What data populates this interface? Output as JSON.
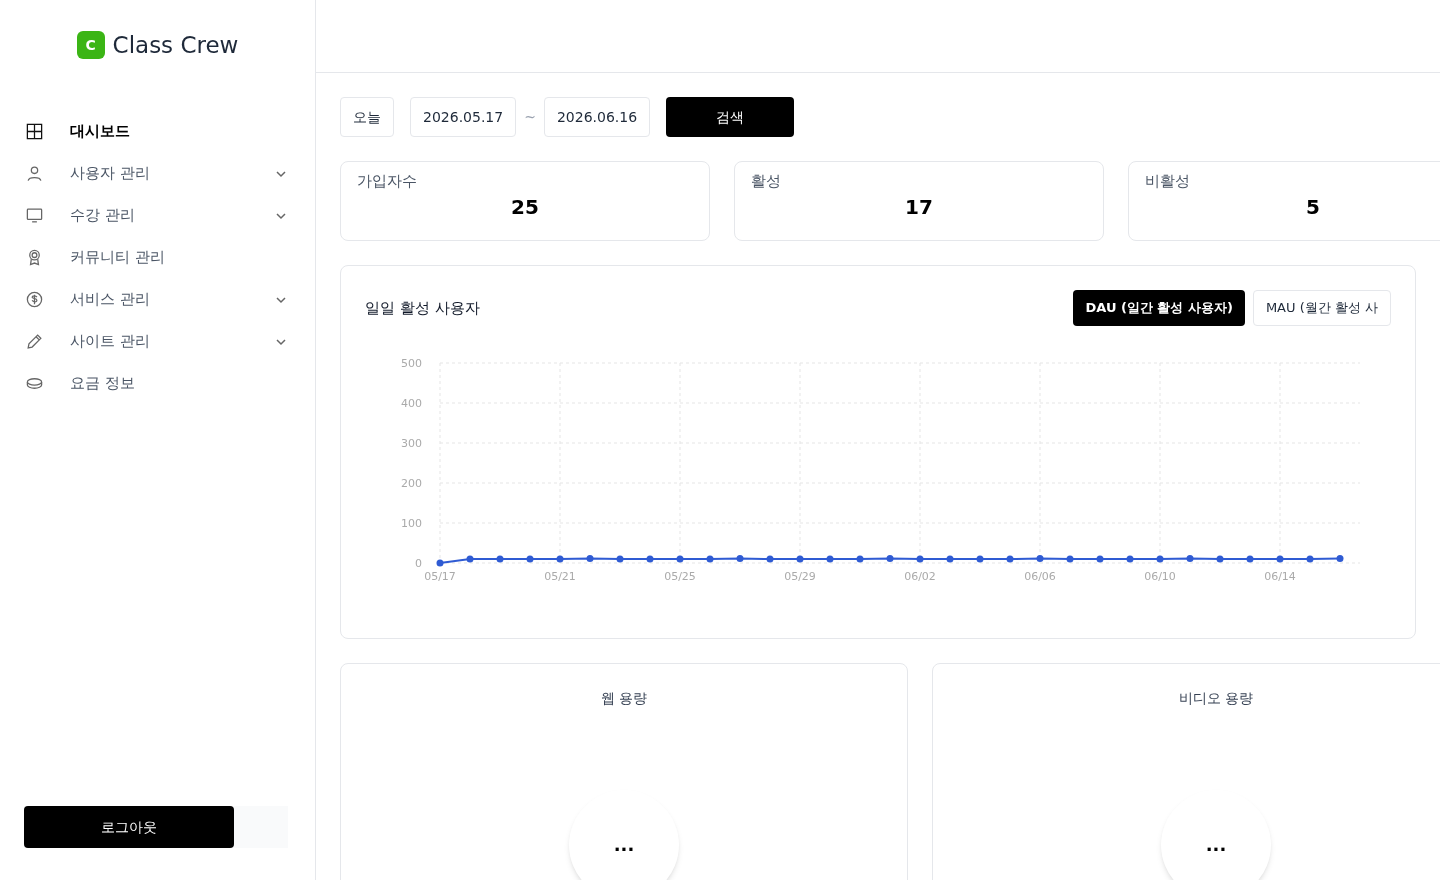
{
  "brand": {
    "logo_letter": "C",
    "name": "Class Crew"
  },
  "sidebar": {
    "items": [
      {
        "kind": "grid",
        "label": "대시보드",
        "selected": true,
        "has_children": false
      },
      {
        "kind": "user",
        "label": "사용자 관리",
        "selected": false,
        "has_children": true
      },
      {
        "kind": "monitor",
        "label": "수강 관리",
        "selected": false,
        "has_children": true
      },
      {
        "kind": "award",
        "label": "커뮤니티 관리",
        "selected": false,
        "has_children": false
      },
      {
        "kind": "dollar",
        "label": "서비스 관리",
        "selected": false,
        "has_children": true
      },
      {
        "kind": "pencil",
        "label": "사이트 관리",
        "selected": false,
        "has_children": true
      },
      {
        "kind": "coin",
        "label": "요금 정보",
        "selected": false,
        "has_children": false
      }
    ],
    "logout": "로그아웃"
  },
  "filters": {
    "today": "오늘",
    "start_date": "2026.05.17",
    "separator": "~",
    "end_date": "2026.06.16",
    "search": "검색"
  },
  "stats": [
    {
      "label": "가입자수",
      "value": "25"
    },
    {
      "label": "활성",
      "value": "17"
    },
    {
      "label": "비활성",
      "value": "5"
    }
  ],
  "activity": {
    "title": "일일 활성 사용자",
    "tabs": [
      {
        "label": "DAU (일간 활성 사용자)",
        "selected": true
      },
      {
        "label": "MAU (월간 활성 사",
        "selected": false
      }
    ],
    "chart_data": {
      "type": "line",
      "grid": true,
      "categories": [
        "05/17",
        null,
        null,
        null,
        "05/21",
        null,
        null,
        null,
        "05/25",
        null,
        null,
        null,
        "05/29",
        null,
        null,
        null,
        "06/02",
        null,
        null,
        null,
        "06/06",
        null,
        null,
        null,
        "06/10",
        null,
        null,
        null,
        "06/14",
        null,
        null
      ],
      "series": [
        {
          "color": "#2f5bd3",
          "marker": true,
          "values": [
            0,
            10,
            10,
            10,
            10,
            11,
            10,
            10,
            10,
            10,
            11,
            10,
            10,
            10,
            10,
            11,
            10,
            10,
            10,
            10,
            11,
            10,
            10,
            10,
            10,
            11,
            10,
            10,
            10,
            10,
            11
          ]
        }
      ],
      "ylim": [
        0,
        500
      ],
      "yticks": [
        0,
        100,
        200,
        300,
        400,
        500
      ]
    }
  },
  "usage": [
    {
      "title": "웹 용량",
      "loading": "..."
    },
    {
      "title": "비디오 용량",
      "loading": "..."
    }
  ]
}
